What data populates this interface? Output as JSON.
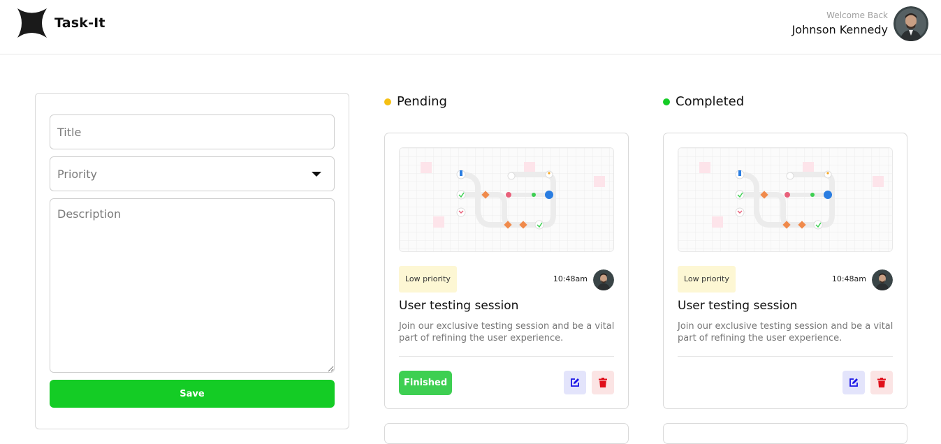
{
  "header": {
    "app_name": "Task-It",
    "welcome": "Welcome Back",
    "user_name": "Johnson Kennedy"
  },
  "form": {
    "title_placeholder": "Title",
    "priority_placeholder": "Priority",
    "description_placeholder": "Description",
    "save_label": "Save"
  },
  "columns": [
    {
      "label": "Pending",
      "dot_color": "#f5c013",
      "task": {
        "priority": "Low priority",
        "time": "10:48am",
        "title": "User testing session",
        "description": "Join our exclusive testing session and be a vital part of refining the user experience.",
        "action_label": "Finished"
      }
    },
    {
      "label": "Completed",
      "dot_color": "#14cc25",
      "task": {
        "priority": "Low priority",
        "time": "10:48am",
        "title": "User testing session",
        "description": "Join our exclusive testing session and be a vital part of refining the user experience."
      }
    }
  ],
  "colors": {
    "accent": "#14cc25",
    "finished": "#3ecf52",
    "edit_icon": "#1a14e6",
    "delete_icon": "#e0101b",
    "priority_badge": "#fdf7d4"
  },
  "icons": [
    "sparkle-logo-icon",
    "user-avatar",
    "caret-down-icon",
    "edit-icon",
    "trash-icon"
  ]
}
